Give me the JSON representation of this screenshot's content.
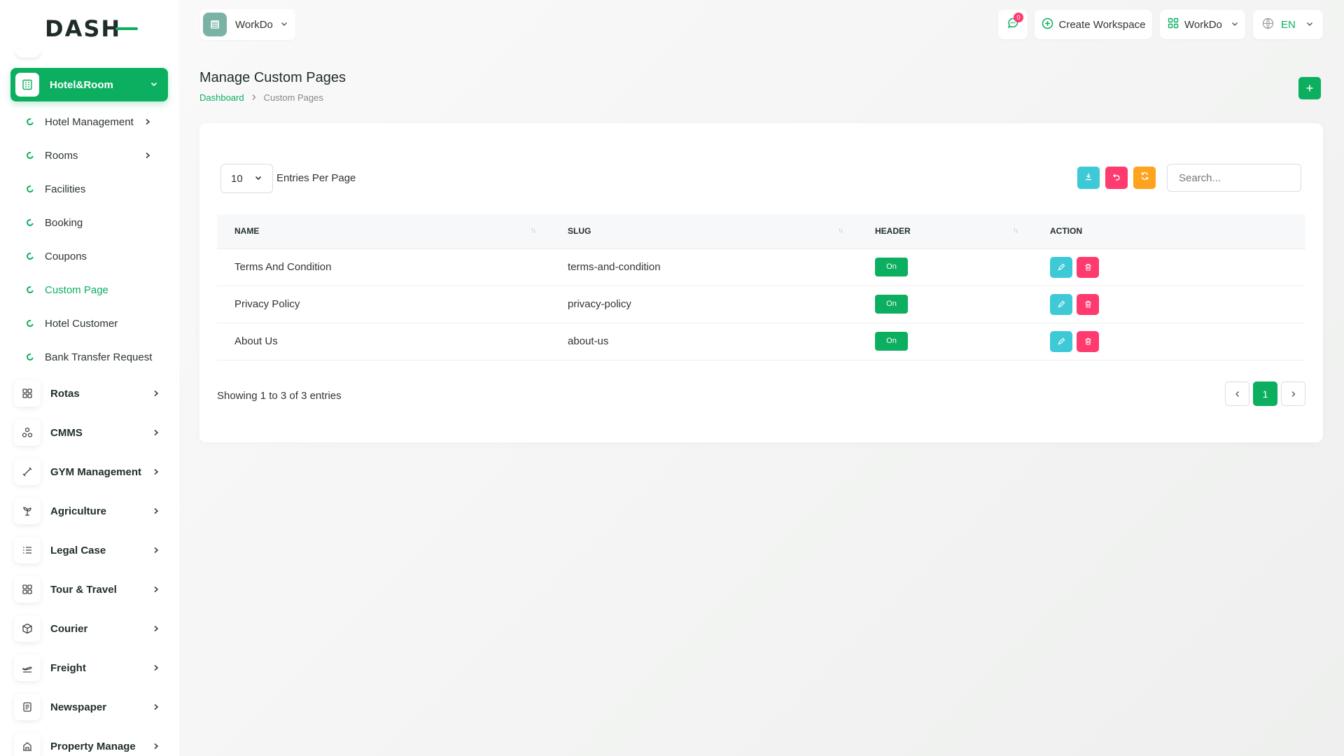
{
  "brand": {
    "logo_text": "DASH"
  },
  "sidebar": {
    "active_module": {
      "label": "Hotel&Room"
    },
    "sub_items": [
      {
        "label": "Hotel Management",
        "has_chevron": true
      },
      {
        "label": "Rooms",
        "has_chevron": true
      },
      {
        "label": "Facilities",
        "has_chevron": false
      },
      {
        "label": "Booking",
        "has_chevron": false
      },
      {
        "label": "Coupons",
        "has_chevron": false
      },
      {
        "label": "Custom Page",
        "has_chevron": false,
        "active": true
      },
      {
        "label": "Hotel Customer",
        "has_chevron": false
      },
      {
        "label": "Bank Transfer Request",
        "has_chevron": false
      }
    ],
    "modules": [
      {
        "label": "Rotas",
        "icon": "grid-icon"
      },
      {
        "label": "CMMS",
        "icon": "nodes-icon"
      },
      {
        "label": "GYM Management",
        "icon": "dumbbell-icon"
      },
      {
        "label": "Agriculture",
        "icon": "plant-icon"
      },
      {
        "label": "Legal Case",
        "icon": "list-check-icon"
      },
      {
        "label": "Tour & Travel",
        "icon": "grid-icon"
      },
      {
        "label": "Courier",
        "icon": "box-icon"
      },
      {
        "label": "Freight",
        "icon": "plane-icon"
      },
      {
        "label": "Newspaper",
        "icon": "newspaper-icon"
      },
      {
        "label": "Property Manage",
        "icon": "building-icon"
      }
    ]
  },
  "header": {
    "workspace": "WorkDo",
    "notification_count": "0",
    "create_workspace": "Create Workspace",
    "workdo_menu": "WorkDo",
    "language": "EN"
  },
  "page": {
    "title": "Manage Custom Pages",
    "breadcrumb_home": "Dashboard",
    "breadcrumb_current": "Custom Pages"
  },
  "table": {
    "per_page_value": "10",
    "per_page_label": "Entries Per Page",
    "search_placeholder": "Search...",
    "columns": [
      "NAME",
      "SLUG",
      "HEADER",
      "ACTION"
    ],
    "rows": [
      {
        "name": "Terms And Condition",
        "slug": "terms-and-condition",
        "header": "On"
      },
      {
        "name": "Privacy Policy",
        "slug": "privacy-policy",
        "header": "On"
      },
      {
        "name": "About Us",
        "slug": "about-us",
        "header": "On"
      }
    ],
    "showing_text": "Showing 1 to 3 of 3 entries",
    "current_page": "1"
  },
  "colors": {
    "accent": "#0caf60",
    "info": "#3ec9d6",
    "danger": "#ff3a6e",
    "warning": "#ffa21d"
  }
}
